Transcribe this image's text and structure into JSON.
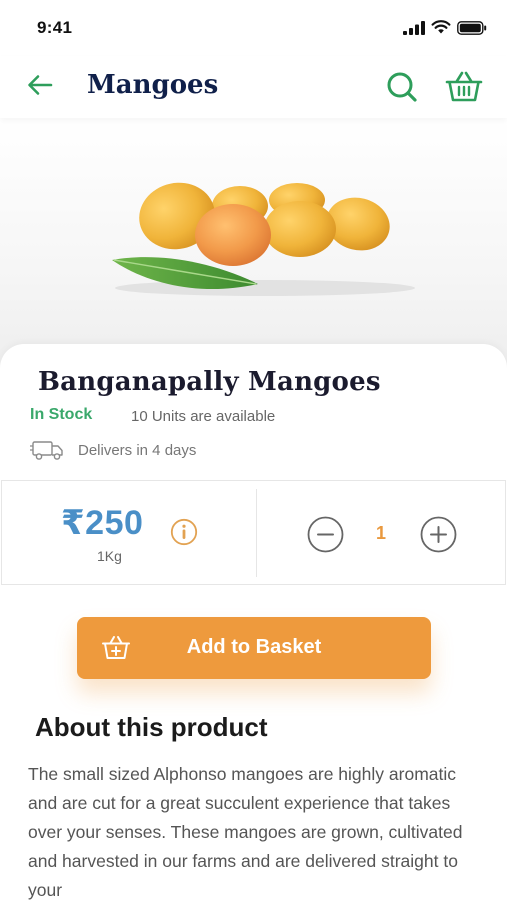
{
  "status_bar": {
    "time": "9:41"
  },
  "app_bar": {
    "title": "Mangoes",
    "icons": [
      "back-arrow-icon",
      "search-icon",
      "basket-icon"
    ]
  },
  "product": {
    "name": "Banganapally Mangoes",
    "stock_status": "In Stock",
    "units_available": "10 Units are available",
    "delivery": "Delivers in 4 days",
    "price": "₹250",
    "unit": "1Kg",
    "quantity": "1"
  },
  "actions": {
    "add_to_basket": "Add to Basket"
  },
  "about": {
    "title": "About this product",
    "text": "The small sized Alphonso mangoes are highly aromatic and are cut for a great succulent experience that takes over your senses. These mangoes are grown, cultivated and harvested in our farms and are delivered straight to your"
  },
  "colors": {
    "brand_green": "#2e9e5b",
    "stock_green": "#3aa86b",
    "price_blue": "#4a8fc7",
    "accent_orange": "#ee9a3d",
    "title_navy": "#10204a"
  }
}
